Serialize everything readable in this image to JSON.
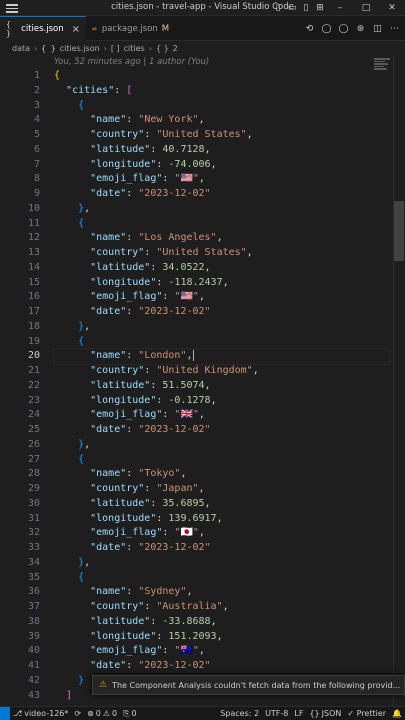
{
  "window": {
    "title": "cities.json - travel-app - Visual Studio Code"
  },
  "tabs": [
    {
      "icon": "{ }",
      "label": "cities.json",
      "active": true,
      "close": "×"
    },
    {
      "icon": "⇌",
      "label": "package.json",
      "modified": "M"
    }
  ],
  "breadcrumb": {
    "folder": "data",
    "file_icon": "{ }",
    "file": "cities.json",
    "array_icon": "[ ]",
    "array": "cities",
    "object_icon": "{ }",
    "object": "2"
  },
  "blame": "You, 52 minutes ago | 1 author (You)",
  "editor": {
    "current_line": 20,
    "lines": [
      [
        [
          "b1",
          "{"
        ]
      ],
      [
        [
          "p",
          "  "
        ],
        [
          "k",
          "\"cities\""
        ],
        [
          "p",
          ": "
        ],
        [
          "b2",
          "["
        ]
      ],
      [
        [
          "p",
          "    "
        ],
        [
          "b3",
          "{"
        ]
      ],
      [
        [
          "p",
          "      "
        ],
        [
          "k",
          "\"name\""
        ],
        [
          "p",
          ": "
        ],
        [
          "s",
          "\"New York\""
        ],
        [
          "p",
          ","
        ]
      ],
      [
        [
          "p",
          "      "
        ],
        [
          "k",
          "\"country\""
        ],
        [
          "p",
          ": "
        ],
        [
          "s",
          "\"United States\""
        ],
        [
          "p",
          ","
        ]
      ],
      [
        [
          "p",
          "      "
        ],
        [
          "k",
          "\"latitude\""
        ],
        [
          "p",
          ": "
        ],
        [
          "n",
          "40.7128"
        ],
        [
          "p",
          ","
        ]
      ],
      [
        [
          "p",
          "      "
        ],
        [
          "k",
          "\"longitude\""
        ],
        [
          "p",
          ": "
        ],
        [
          "n",
          "-74.006"
        ],
        [
          "p",
          ","
        ]
      ],
      [
        [
          "p",
          "      "
        ],
        [
          "k",
          "\"emoji_flag\""
        ],
        [
          "p",
          ": "
        ],
        [
          "s",
          "\"🇺🇸\""
        ],
        [
          "p",
          ","
        ]
      ],
      [
        [
          "p",
          "      "
        ],
        [
          "k",
          "\"date\""
        ],
        [
          "p",
          ": "
        ],
        [
          "s",
          "\"2023-12-02\""
        ]
      ],
      [
        [
          "p",
          "    "
        ],
        [
          "b3",
          "}"
        ],
        [
          "p",
          ","
        ]
      ],
      [
        [
          "p",
          "    "
        ],
        [
          "b3",
          "{"
        ]
      ],
      [
        [
          "p",
          "      "
        ],
        [
          "k",
          "\"name\""
        ],
        [
          "p",
          ": "
        ],
        [
          "s",
          "\"Los Angeles\""
        ],
        [
          "p",
          ","
        ]
      ],
      [
        [
          "p",
          "      "
        ],
        [
          "k",
          "\"country\""
        ],
        [
          "p",
          ": "
        ],
        [
          "s",
          "\"United States\""
        ],
        [
          "p",
          ","
        ]
      ],
      [
        [
          "p",
          "      "
        ],
        [
          "k",
          "\"latitude\""
        ],
        [
          "p",
          ": "
        ],
        [
          "n",
          "34.0522"
        ],
        [
          "p",
          ","
        ]
      ],
      [
        [
          "p",
          "      "
        ],
        [
          "k",
          "\"longitude\""
        ],
        [
          "p",
          ": "
        ],
        [
          "n",
          "-118.2437"
        ],
        [
          "p",
          ","
        ]
      ],
      [
        [
          "p",
          "      "
        ],
        [
          "k",
          "\"emoji_flag\""
        ],
        [
          "p",
          ": "
        ],
        [
          "s",
          "\"🇺🇸\""
        ],
        [
          "p",
          ","
        ]
      ],
      [
        [
          "p",
          "      "
        ],
        [
          "k",
          "\"date\""
        ],
        [
          "p",
          ": "
        ],
        [
          "s",
          "\"2023-12-02\""
        ]
      ],
      [
        [
          "p",
          "    "
        ],
        [
          "b3",
          "}"
        ],
        [
          "p",
          ","
        ]
      ],
      [
        [
          "p",
          "    "
        ],
        [
          "b3",
          "{"
        ]
      ],
      [
        [
          "p",
          "      "
        ],
        [
          "k",
          "\"name\""
        ],
        [
          "p",
          ": "
        ],
        [
          "s",
          "\"London\""
        ],
        [
          "p",
          ","
        ]
      ],
      [
        [
          "p",
          "      "
        ],
        [
          "k",
          "\"country\""
        ],
        [
          "p",
          ": "
        ],
        [
          "s",
          "\"United Kingdom\""
        ],
        [
          "p",
          ","
        ]
      ],
      [
        [
          "p",
          "      "
        ],
        [
          "k",
          "\"latitude\""
        ],
        [
          "p",
          ": "
        ],
        [
          "n",
          "51.5074"
        ],
        [
          "p",
          ","
        ]
      ],
      [
        [
          "p",
          "      "
        ],
        [
          "k",
          "\"longitude\""
        ],
        [
          "p",
          ": "
        ],
        [
          "n",
          "-0.1278"
        ],
        [
          "p",
          ","
        ]
      ],
      [
        [
          "p",
          "      "
        ],
        [
          "k",
          "\"emoji_flag\""
        ],
        [
          "p",
          ": "
        ],
        [
          "s",
          "\"🇬🇧\""
        ],
        [
          "p",
          ","
        ]
      ],
      [
        [
          "p",
          "      "
        ],
        [
          "k",
          "\"date\""
        ],
        [
          "p",
          ": "
        ],
        [
          "s",
          "\"2023-12-02\""
        ]
      ],
      [
        [
          "p",
          "    "
        ],
        [
          "b3",
          "}"
        ],
        [
          "p",
          ","
        ]
      ],
      [
        [
          "p",
          "    "
        ],
        [
          "b3",
          "{"
        ]
      ],
      [
        [
          "p",
          "      "
        ],
        [
          "k",
          "\"name\""
        ],
        [
          "p",
          ": "
        ],
        [
          "s",
          "\"Tokyo\""
        ],
        [
          "p",
          ","
        ]
      ],
      [
        [
          "p",
          "      "
        ],
        [
          "k",
          "\"country\""
        ],
        [
          "p",
          ": "
        ],
        [
          "s",
          "\"Japan\""
        ],
        [
          "p",
          ","
        ]
      ],
      [
        [
          "p",
          "      "
        ],
        [
          "k",
          "\"latitude\""
        ],
        [
          "p",
          ": "
        ],
        [
          "n",
          "35.6895"
        ],
        [
          "p",
          ","
        ]
      ],
      [
        [
          "p",
          "      "
        ],
        [
          "k",
          "\"longitude\""
        ],
        [
          "p",
          ": "
        ],
        [
          "n",
          "139.6917"
        ],
        [
          "p",
          ","
        ]
      ],
      [
        [
          "p",
          "      "
        ],
        [
          "k",
          "\"emoji_flag\""
        ],
        [
          "p",
          ": "
        ],
        [
          "s",
          "\"🇯🇵\""
        ],
        [
          "p",
          ","
        ]
      ],
      [
        [
          "p",
          "      "
        ],
        [
          "k",
          "\"date\""
        ],
        [
          "p",
          ": "
        ],
        [
          "s",
          "\"2023-12-02\""
        ]
      ],
      [
        [
          "p",
          "    "
        ],
        [
          "b3",
          "}"
        ],
        [
          "p",
          ","
        ]
      ],
      [
        [
          "p",
          "    "
        ],
        [
          "b3",
          "{"
        ]
      ],
      [
        [
          "p",
          "      "
        ],
        [
          "k",
          "\"name\""
        ],
        [
          "p",
          ": "
        ],
        [
          "s",
          "\"Sydney\""
        ],
        [
          "p",
          ","
        ]
      ],
      [
        [
          "p",
          "      "
        ],
        [
          "k",
          "\"country\""
        ],
        [
          "p",
          ": "
        ],
        [
          "s",
          "\"Australia\""
        ],
        [
          "p",
          ","
        ]
      ],
      [
        [
          "p",
          "      "
        ],
        [
          "k",
          "\"latitude\""
        ],
        [
          "p",
          ": "
        ],
        [
          "n",
          "-33.8688"
        ],
        [
          "p",
          ","
        ]
      ],
      [
        [
          "p",
          "      "
        ],
        [
          "k",
          "\"longitude\""
        ],
        [
          "p",
          ": "
        ],
        [
          "n",
          "151.2093"
        ],
        [
          "p",
          ","
        ]
      ],
      [
        [
          "p",
          "      "
        ],
        [
          "k",
          "\"emoji_flag\""
        ],
        [
          "p",
          ": "
        ],
        [
          "s",
          "\"🇦🇺\""
        ],
        [
          "p",
          ","
        ]
      ],
      [
        [
          "p",
          "      "
        ],
        [
          "k",
          "\"date\""
        ],
        [
          "p",
          ": "
        ],
        [
          "s",
          "\"2023-12-02\""
        ]
      ],
      [
        [
          "p",
          "    "
        ],
        [
          "b3",
          "}"
        ]
      ],
      [
        [
          "p",
          "  "
        ],
        [
          "b2",
          "]"
        ]
      ]
    ]
  },
  "notification": {
    "icon": "⚠",
    "text": "The Component Analysis couldn't fetch data from the following provid..."
  },
  "statusbar": {
    "branch": "video-126*",
    "sync": "⟳",
    "errors": "0",
    "warnings": "0",
    "ports": "0",
    "spaces": "Spaces: 2",
    "encoding": "UTF-8",
    "eol": "LF",
    "language": "JSON",
    "prettier": "✓ Prettier",
    "bell": "🔔"
  }
}
